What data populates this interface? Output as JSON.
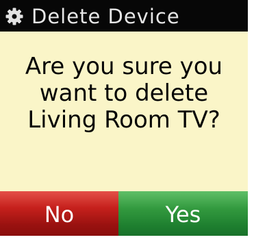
{
  "dialog": {
    "title": "Delete Device",
    "title_icon": "gear-icon",
    "message_lines": [
      "Are you sure you",
      "want to delete",
      "Living Room TV?"
    ]
  },
  "buttons": {
    "no_label": "No",
    "yes_label": "Yes"
  },
  "colors": {
    "background": "#faf5c8",
    "titlebar": "#070707",
    "no_button": "#c5201c",
    "yes_button": "#32993e"
  }
}
